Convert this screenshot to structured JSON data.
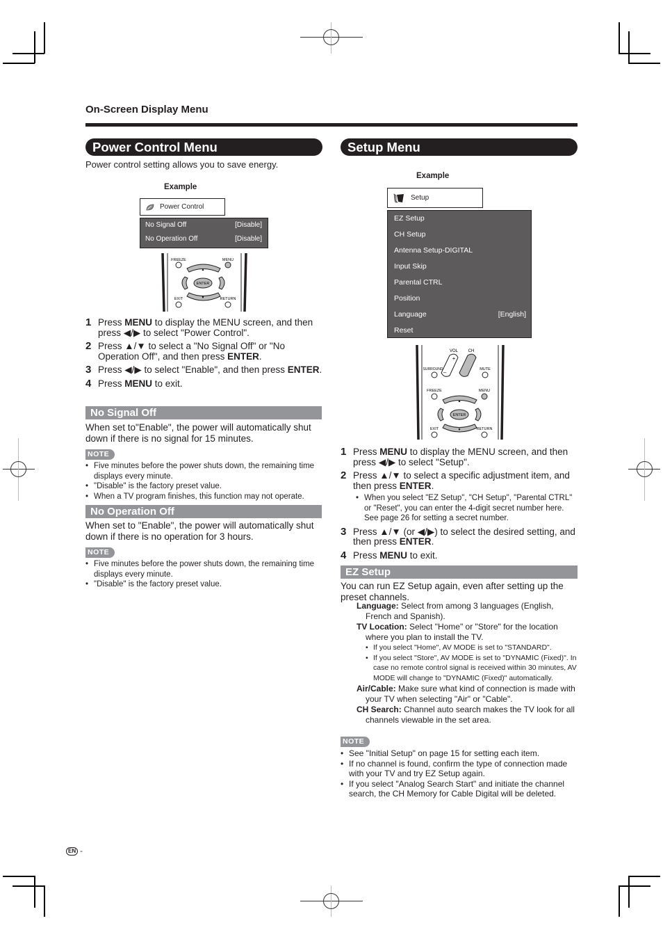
{
  "page": {
    "section_label": "On-Screen Display Menu",
    "footer": {
      "lang_badge": "EN",
      "page_suffix": "-"
    }
  },
  "power_control": {
    "title": "Power Control Menu",
    "intro": "Power control setting allows you to save energy.",
    "example_label": "Example",
    "osd": {
      "header_icon": "leaf-icon",
      "header_label": "Power Control",
      "rows": [
        {
          "label": "No Signal Off",
          "value": "[Disable]"
        },
        {
          "label": "No Operation Off",
          "value": "[Disable]"
        }
      ]
    },
    "remote": {
      "freeze": "FREEZE",
      "menu": "MENU",
      "enter": "ENTER",
      "exit": "EXIT",
      "return": "RETURN"
    },
    "steps": [
      {
        "num": "1",
        "pre": "Press ",
        "bold": "MENU",
        "post": " to display the MENU screen, and then press ◀/▶ to select \"Power Control\"."
      },
      {
        "num": "2",
        "pre": "Press ▲/▼ to select a \"No Signal Off\" or \"No Operation Off\", and then press ",
        "bold": "ENTER",
        "post": "."
      },
      {
        "num": "3",
        "pre": "Press ◀/▶ to select \"Enable\", and then press ",
        "bold": "ENTER",
        "post": "."
      },
      {
        "num": "4",
        "pre": "Press ",
        "bold": "MENU",
        "post": " to exit."
      }
    ],
    "no_signal_off": {
      "title": "No Signal Off",
      "text": "When set to\"Enable\", the power will automatically shut down if there is no signal for 15 minutes.",
      "note_label": "NOTE",
      "notes": [
        "Five minutes before the power shuts down, the remaining time displays every minute.",
        "\"Disable\" is the factory preset value.",
        "When a TV program finishes, this function may not operate."
      ]
    },
    "no_operation_off": {
      "title": "No Operation Off",
      "text": "When set to \"Enable\", the power will automatically shut down if there is no operation for 3 hours.",
      "note_label": "NOTE",
      "notes": [
        "Five minutes before the power shuts down, the remaining time displays every minute.",
        "\"Disable\" is the factory preset value."
      ]
    }
  },
  "setup_menu": {
    "title": "Setup Menu",
    "example_label": "Example",
    "osd": {
      "header_icon": "setup-tool-icon",
      "header_label": "Setup",
      "rows": [
        {
          "label": "EZ Setup",
          "value": ""
        },
        {
          "label": "CH Setup",
          "value": ""
        },
        {
          "label": "Antenna Setup-DIGITAL",
          "value": ""
        },
        {
          "label": "Input Skip",
          "value": ""
        },
        {
          "label": "Parental CTRL",
          "value": ""
        },
        {
          "label": "Position",
          "value": ""
        },
        {
          "label": "Language",
          "value": "[English]"
        },
        {
          "label": "Reset",
          "value": ""
        }
      ]
    },
    "remote": {
      "vol": "VOL",
      "ch": "CH",
      "surround": "SURROUND",
      "mute": "MUTE",
      "freeze": "FREEZE",
      "menu": "MENU",
      "enter": "ENTER",
      "exit": "EXIT",
      "return": "RETURN"
    },
    "steps": [
      {
        "num": "1",
        "pre": "Press ",
        "bold": "MENU",
        "post": " to display the MENU screen, and then press ◀/▶ to select \"Setup\"."
      },
      {
        "num": "2",
        "pre": "Press ▲/▼ to select a specific adjustment item, and then press ",
        "bold": "ENTER",
        "post": ".",
        "sub": "When you select \"EZ Setup\", \"CH Setup\", \"Parental CTRL\" or \"Reset\", you can enter the 4-digit secret number here. See page 26 for setting a secret number."
      },
      {
        "num": "3",
        "pre": "Press ▲/▼ (or ◀/▶) to select the desired setting, and then press ",
        "bold": "ENTER",
        "post": "."
      },
      {
        "num": "4",
        "pre": "Press ",
        "bold": "MENU",
        "post": " to exit."
      }
    ],
    "ez_setup": {
      "title": "EZ Setup",
      "text": "You can run EZ Setup again, even after setting up the preset channels.",
      "items": [
        {
          "term": "Language:",
          "desc": " Select from among 3 languages (English, French and Spanish).",
          "subs": []
        },
        {
          "term": "TV Location:",
          "desc": " Select \"Home\" or \"Store\" for the location where you plan to install the TV.",
          "subs": [
            "If you select \"Home\", AV MODE is set to \"STANDARD\".",
            "If you select \"Store\", AV MODE is set to \"DYNAMIC (Fixed)\". In case no remote control signal is received within 30 minutes, AV MODE will change to \"DYNAMIC (Fixed)\" automatically."
          ]
        },
        {
          "term": "Air/Cable:",
          "desc": " Make sure what kind of connection is made with your TV when selecting \"Air\" or \"Cable\".",
          "subs": []
        },
        {
          "term": "CH Search:",
          "desc": " Channel auto search makes the TV look for all channels viewable in the set area.",
          "subs": []
        }
      ],
      "note_label": "NOTE",
      "notes": [
        "See \"Initial Setup\" on page 15 for setting each item.",
        "If no channel is found, confirm the type of connection made with your TV and try EZ Setup again.",
        "If you select \"Analog Search Start\" and initiate the channel search, the CH Memory for Cable Digital will be deleted."
      ]
    }
  }
}
